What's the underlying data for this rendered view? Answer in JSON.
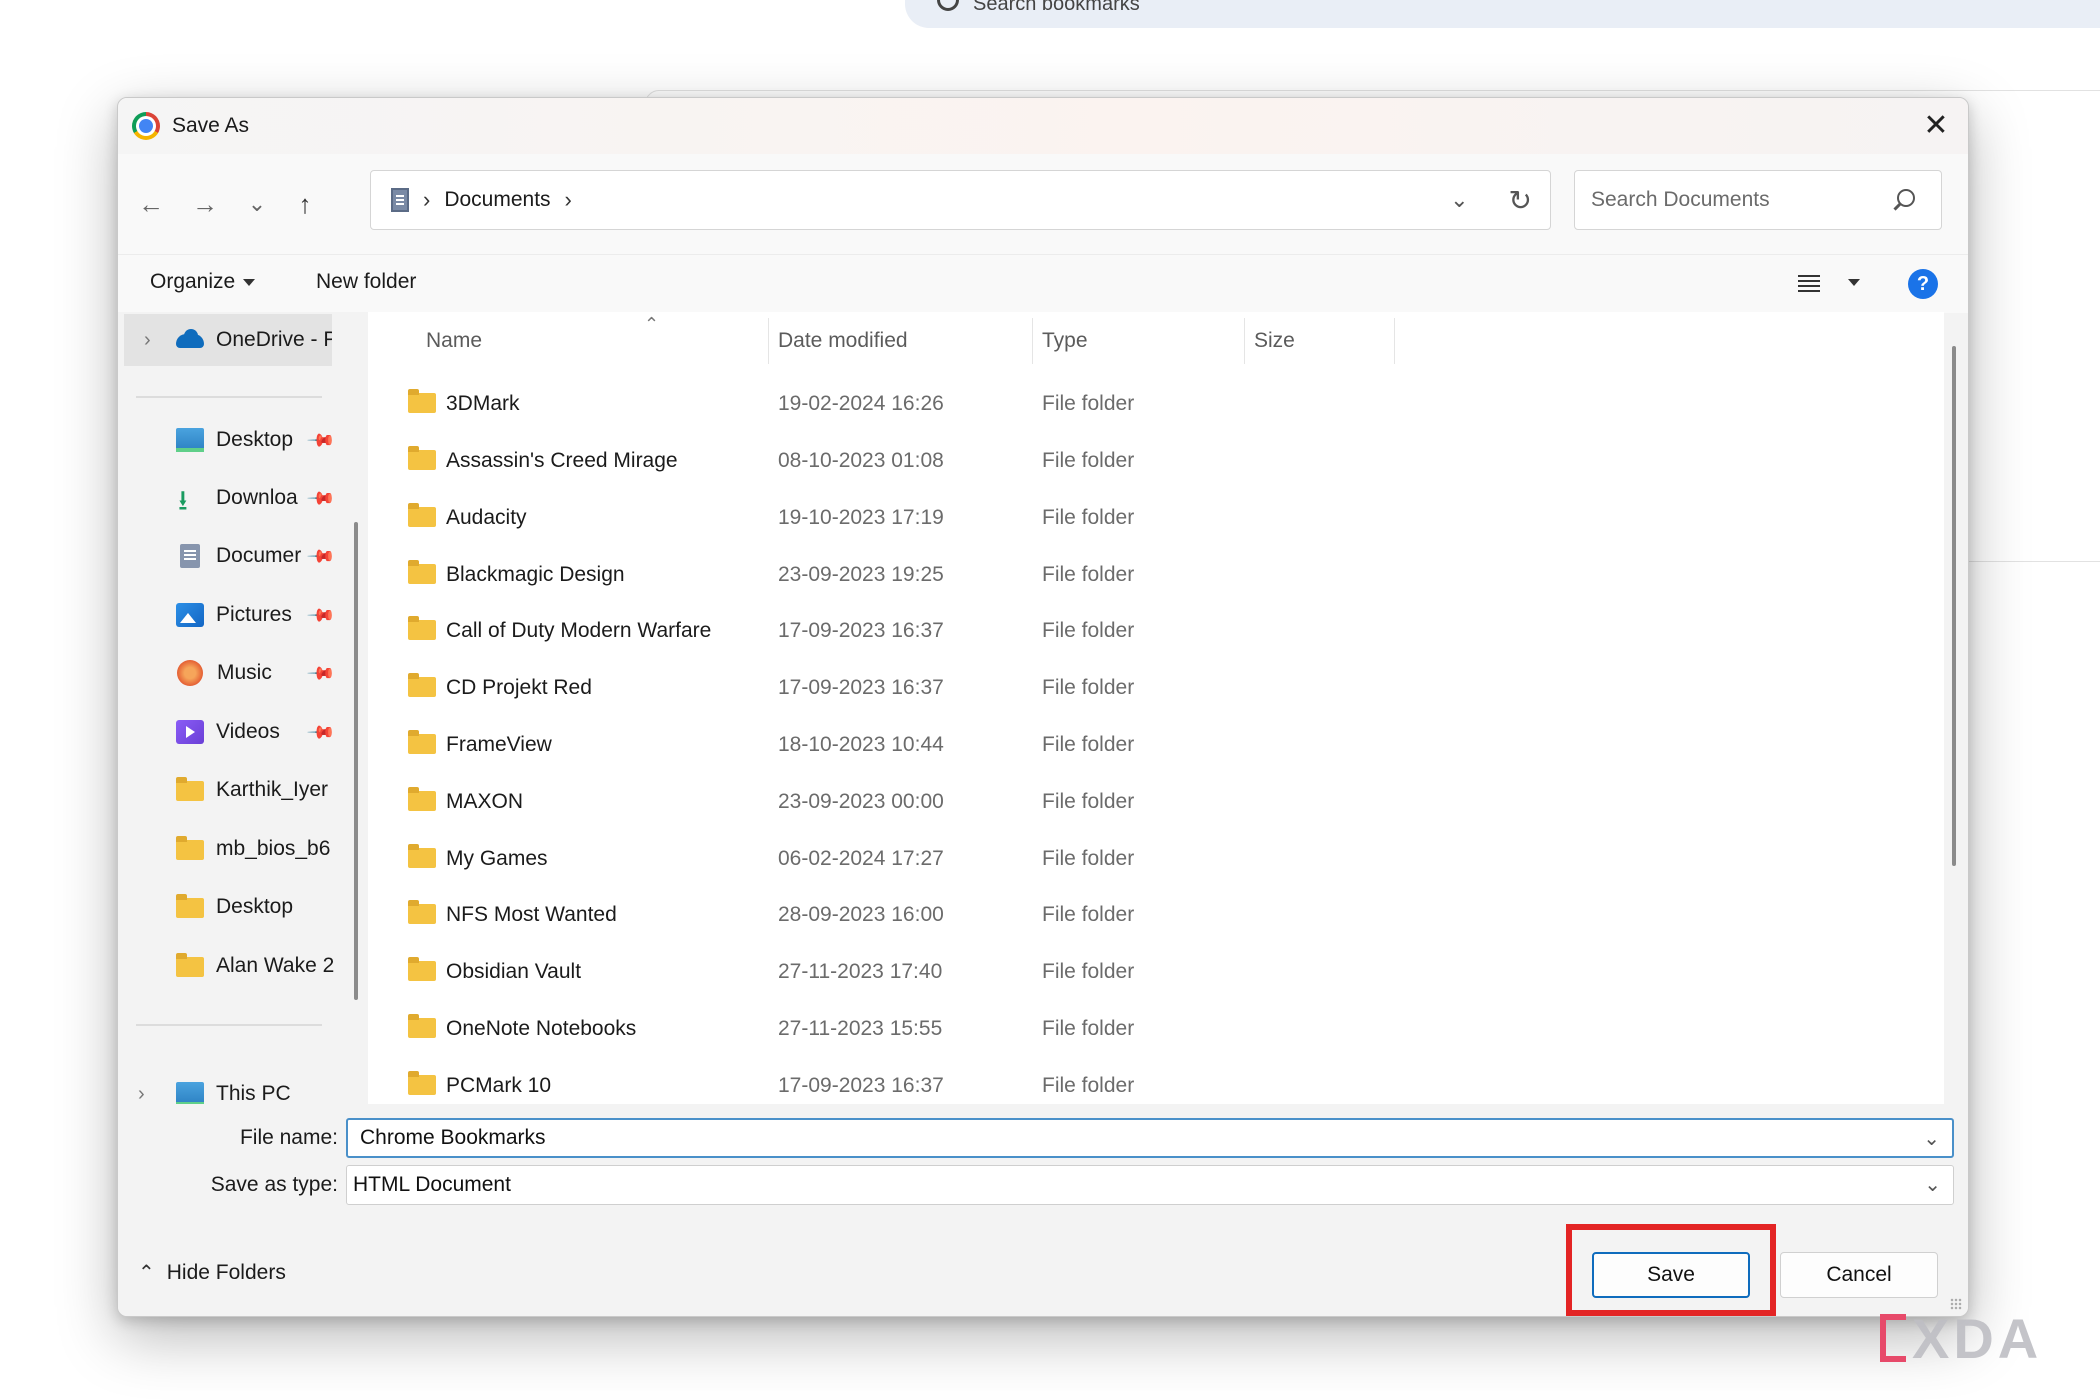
{
  "background": {
    "search_placeholder": "Search bookmarks"
  },
  "dialog": {
    "title": "Save As",
    "close_glyph": "✕"
  },
  "nav": {
    "back": "←",
    "forward": "→",
    "recent": "⌄",
    "up": "↑",
    "address": {
      "location": "Documents",
      "sep": "›",
      "dropdown": "⌄",
      "refresh": "↻"
    },
    "search": {
      "placeholder": "Search Documents",
      "value": ""
    }
  },
  "toolbar": {
    "organize": "Organize",
    "new_folder": "New folder",
    "help": "?"
  },
  "sidebar": {
    "onedrive": "OneDrive - P",
    "quick_access": [
      {
        "label": "Desktop",
        "icon": "desktop-icon",
        "pinned": true
      },
      {
        "label": "Downloa",
        "icon": "download-icon",
        "pinned": true
      },
      {
        "label": "Documer",
        "icon": "documents-icon",
        "pinned": true
      },
      {
        "label": "Pictures",
        "icon": "pictures-icon",
        "pinned": true
      },
      {
        "label": "Music",
        "icon": "music-icon",
        "pinned": true
      },
      {
        "label": "Videos",
        "icon": "videos-icon",
        "pinned": true
      },
      {
        "label": "Karthik_Iyer",
        "icon": "folder-icon",
        "pinned": false
      },
      {
        "label": "mb_bios_b6",
        "icon": "folder-icon",
        "pinned": false
      },
      {
        "label": "Desktop",
        "icon": "folder-icon",
        "pinned": false
      },
      {
        "label": "Alan Wake 2",
        "icon": "folder-icon",
        "pinned": false
      }
    ],
    "this_pc": "This PC"
  },
  "columns": {
    "name": "Name",
    "date_modified": "Date modified",
    "type": "Type",
    "size": "Size"
  },
  "files": [
    {
      "name": "3DMark",
      "date": "19-02-2024 16:26",
      "type": "File folder"
    },
    {
      "name": "Assassin's Creed Mirage",
      "date": "08-10-2023 01:08",
      "type": "File folder"
    },
    {
      "name": "Audacity",
      "date": "19-10-2023 17:19",
      "type": "File folder"
    },
    {
      "name": "Blackmagic Design",
      "date": "23-09-2023 19:25",
      "type": "File folder"
    },
    {
      "name": "Call of Duty Modern Warfare",
      "date": "17-09-2023 16:37",
      "type": "File folder"
    },
    {
      "name": "CD Projekt Red",
      "date": "17-09-2023 16:37",
      "type": "File folder"
    },
    {
      "name": "FrameView",
      "date": "18-10-2023 10:44",
      "type": "File folder"
    },
    {
      "name": "MAXON",
      "date": "23-09-2023 00:00",
      "type": "File folder"
    },
    {
      "name": "My Games",
      "date": "06-02-2024 17:27",
      "type": "File folder"
    },
    {
      "name": "NFS Most Wanted",
      "date": "28-09-2023 16:00",
      "type": "File folder"
    },
    {
      "name": "Obsidian Vault",
      "date": "27-11-2023 17:40",
      "type": "File folder"
    },
    {
      "name": "OneNote Notebooks",
      "date": "27-11-2023 15:55",
      "type": "File folder"
    },
    {
      "name": "PCMark 10",
      "date": "17-09-2023 16:37",
      "type": "File folder"
    }
  ],
  "form": {
    "file_name_label": "File name:",
    "file_name_value": "Chrome Bookmarks",
    "save_type_label": "Save as type:",
    "save_type_value": "HTML Document"
  },
  "footer": {
    "hide_folders": "Hide Folders",
    "save": "Save",
    "cancel": "Cancel"
  },
  "colors": {
    "highlight": "#e32424",
    "accent": "#0f6cbd"
  },
  "watermark": "XDA"
}
